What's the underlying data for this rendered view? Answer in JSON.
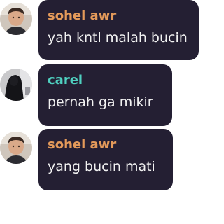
{
  "messages": [
    {
      "author": "sohel awr",
      "author_color": "#e49a5a",
      "text": "yah kntl malah bucin",
      "avatar": "user-photo-avatar"
    },
    {
      "author": "carel",
      "author_color": "#4fd0c0",
      "text": "pernah ga mikir",
      "avatar": "dark-photo-avatar"
    },
    {
      "author": "sohel awr",
      "author_color": "#e49a5a",
      "text": "yang bucin mati",
      "avatar": "user-photo-avatar"
    }
  ]
}
